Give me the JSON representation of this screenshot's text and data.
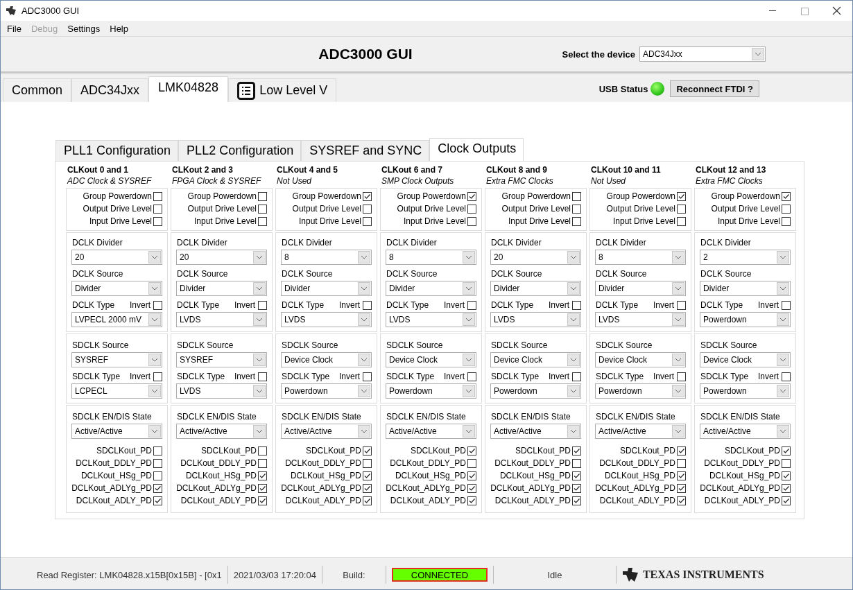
{
  "window": {
    "title": "ADC3000 GUI"
  },
  "menu": [
    {
      "label": "File",
      "disabled": false
    },
    {
      "label": "Debug",
      "disabled": true
    },
    {
      "label": "Settings",
      "disabled": false
    },
    {
      "label": "Help",
      "disabled": false
    }
  ],
  "header": {
    "title": "ADC3000 GUI",
    "device_label": "Select the device",
    "device_value": "ADC34Jxx"
  },
  "main_tabs": [
    {
      "label": "Common",
      "kind": "text",
      "selected": false
    },
    {
      "label": "ADC34Jxx",
      "kind": "text",
      "selected": false
    },
    {
      "label": "LMK04828",
      "kind": "text",
      "selected": true
    },
    {
      "label": "Low Level V",
      "kind": "icon",
      "selected": false
    }
  ],
  "usb": {
    "label": "USB Status",
    "connected": true,
    "button": "Reconnect FTDI ?"
  },
  "sub_tabs": [
    {
      "label": "PLL1 Configuration",
      "selected": false
    },
    {
      "label": "PLL2 Configuration",
      "selected": false
    },
    {
      "label": "SYSREF and SYNC",
      "selected": false
    },
    {
      "label": "Clock Outputs",
      "selected": true
    }
  ],
  "columns": [
    {
      "title": "CLKout 0 and 1",
      "subtitle": "ADC Clock & SYSREF",
      "top_checks": [
        {
          "label": "Group Powerdown",
          "checked": false
        },
        {
          "label": "Output Drive Level",
          "checked": false
        },
        {
          "label": "Input Drive Level",
          "checked": false
        }
      ],
      "dclk_divider": {
        "label": "DCLK Divider",
        "value": "20"
      },
      "dclk_source": {
        "label": "DCLK Source",
        "value": "Divider"
      },
      "dclk_type": {
        "label": "DCLK Type",
        "invert_label": "Invert",
        "invert": false,
        "value": "LVPECL 2000 mV"
      },
      "sdclk_source": {
        "label": "SDCLK Source",
        "value": "SYSREF"
      },
      "sdclk_type": {
        "label": "SDCLK Type",
        "invert_label": "Invert",
        "invert": false,
        "value": "LCPECL"
      },
      "sdclk_state": {
        "label": "SDCLK EN/DIS State",
        "value": "Active/Active"
      },
      "pd_checks": [
        {
          "label": "SDCLKout_PD",
          "checked": false
        },
        {
          "label": "DCLKout_DDLY_PD",
          "checked": false
        },
        {
          "label": "DCLKout_HSg_PD",
          "checked": false
        },
        {
          "label": "DCLKout_ADLYg_PD",
          "checked": true
        },
        {
          "label": "DCLKout_ADLY_PD",
          "checked": true
        }
      ]
    },
    {
      "title": "CLKout 2 and 3",
      "subtitle": "FPGA Clock & SYSREF",
      "top_checks": [
        {
          "label": "Group Powerdown",
          "checked": false
        },
        {
          "label": "Output Drive Level",
          "checked": false
        },
        {
          "label": "Input Drive Level",
          "checked": false
        }
      ],
      "dclk_divider": {
        "label": "DCLK Divider",
        "value": "20"
      },
      "dclk_source": {
        "label": "DCLK Source",
        "value": "Divider"
      },
      "dclk_type": {
        "label": "DCLK Type",
        "invert_label": "Invert",
        "invert": false,
        "value": "LVDS"
      },
      "sdclk_source": {
        "label": "SDCLK Source",
        "value": "SYSREF"
      },
      "sdclk_type": {
        "label": "SDCLK Type",
        "invert_label": "Invert",
        "invert": false,
        "value": "LVDS"
      },
      "sdclk_state": {
        "label": "SDCLK EN/DIS State",
        "value": "Active/Active"
      },
      "pd_checks": [
        {
          "label": "SDCLKout_PD",
          "checked": false
        },
        {
          "label": "DCLKout_DDLY_PD",
          "checked": false
        },
        {
          "label": "DCLKout_HSg_PD",
          "checked": true
        },
        {
          "label": "DCLKout_ADLYg_PD",
          "checked": true
        },
        {
          "label": "DCLKout_ADLY_PD",
          "checked": true
        }
      ]
    },
    {
      "title": "CLKout 4 and 5",
      "subtitle": "Not Used",
      "top_checks": [
        {
          "label": "Group Powerdown",
          "checked": true
        },
        {
          "label": "Output Drive Level",
          "checked": false
        },
        {
          "label": "Input Drive Level",
          "checked": false
        }
      ],
      "dclk_divider": {
        "label": "DCLK Divider",
        "value": "8"
      },
      "dclk_source": {
        "label": "DCLK Source",
        "value": "Divider"
      },
      "dclk_type": {
        "label": "DCLK Type",
        "invert_label": "Invert",
        "invert": false,
        "value": "LVDS"
      },
      "sdclk_source": {
        "label": "SDCLK Source",
        "value": "Device Clock"
      },
      "sdclk_type": {
        "label": "SDCLK Type",
        "invert_label": "Invert",
        "invert": false,
        "value": "Powerdown"
      },
      "sdclk_state": {
        "label": "SDCLK EN/DIS State",
        "value": "Active/Active"
      },
      "pd_checks": [
        {
          "label": "SDCLKout_PD",
          "checked": true
        },
        {
          "label": "DCLKout_DDLY_PD",
          "checked": false
        },
        {
          "label": "DCLKout_HSg_PD",
          "checked": true
        },
        {
          "label": "DCLKout_ADLYg_PD",
          "checked": true
        },
        {
          "label": "DCLKout_ADLY_PD",
          "checked": true
        }
      ]
    },
    {
      "title": "CLKout 6 and 7",
      "subtitle": "SMP Clock Outputs",
      "top_checks": [
        {
          "label": "Group Powerdown",
          "checked": true
        },
        {
          "label": "Output Drive Level",
          "checked": false
        },
        {
          "label": "Input Drive Level",
          "checked": false
        }
      ],
      "dclk_divider": {
        "label": "DCLK Divider",
        "value": "8"
      },
      "dclk_source": {
        "label": "DCLK Source",
        "value": "Divider"
      },
      "dclk_type": {
        "label": "DCLK Type",
        "invert_label": "Invert",
        "invert": false,
        "value": "LVDS"
      },
      "sdclk_source": {
        "label": "SDCLK Source",
        "value": "Device Clock"
      },
      "sdclk_type": {
        "label": "SDCLK Type",
        "invert_label": "Invert",
        "invert": false,
        "value": "Powerdown"
      },
      "sdclk_state": {
        "label": "SDCLK EN/DIS State",
        "value": "Active/Active"
      },
      "pd_checks": [
        {
          "label": "SDCLKout_PD",
          "checked": true
        },
        {
          "label": "DCLKout_DDLY_PD",
          "checked": false
        },
        {
          "label": "DCLKout_HSg_PD",
          "checked": true
        },
        {
          "label": "DCLKout_ADLYg_PD",
          "checked": true
        },
        {
          "label": "DCLKout_ADLY_PD",
          "checked": true
        }
      ]
    },
    {
      "title": "CLKout 8 and 9",
      "subtitle": "Extra FMC Clocks",
      "top_checks": [
        {
          "label": "Group Powerdown",
          "checked": false
        },
        {
          "label": "Output Drive Level",
          "checked": false
        },
        {
          "label": "Input Drive Level",
          "checked": false
        }
      ],
      "dclk_divider": {
        "label": "DCLK Divider",
        "value": "20"
      },
      "dclk_source": {
        "label": "DCLK Source",
        "value": "Divider"
      },
      "dclk_type": {
        "label": "DCLK Type",
        "invert_label": "Invert",
        "invert": false,
        "value": "LVDS"
      },
      "sdclk_source": {
        "label": "SDCLK Source",
        "value": "Device Clock"
      },
      "sdclk_type": {
        "label": "SDCLK Type",
        "invert_label": "Invert",
        "invert": false,
        "value": "Powerdown"
      },
      "sdclk_state": {
        "label": "SDCLK EN/DIS State",
        "value": "Active/Active"
      },
      "pd_checks": [
        {
          "label": "SDCLKout_PD",
          "checked": true
        },
        {
          "label": "DCLKout_DDLY_PD",
          "checked": false
        },
        {
          "label": "DCLKout_HSg_PD",
          "checked": true
        },
        {
          "label": "DCLKout_ADLYg_PD",
          "checked": true
        },
        {
          "label": "DCLKout_ADLY_PD",
          "checked": true
        }
      ]
    },
    {
      "title": "CLKout 10 and 11",
      "subtitle": "Not Used",
      "top_checks": [
        {
          "label": "Group Powerdown",
          "checked": true
        },
        {
          "label": "Output Drive Level",
          "checked": false
        },
        {
          "label": "Input Drive Level",
          "checked": false
        }
      ],
      "dclk_divider": {
        "label": "DCLK Divider",
        "value": "8"
      },
      "dclk_source": {
        "label": "DCLK Source",
        "value": "Divider"
      },
      "dclk_type": {
        "label": "DCLK Type",
        "invert_label": "Invert",
        "invert": false,
        "value": "LVDS"
      },
      "sdclk_source": {
        "label": "SDCLK Source",
        "value": "Device Clock"
      },
      "sdclk_type": {
        "label": "SDCLK Type",
        "invert_label": "Invert",
        "invert": false,
        "value": "Powerdown"
      },
      "sdclk_state": {
        "label": "SDCLK EN/DIS State",
        "value": "Active/Active"
      },
      "pd_checks": [
        {
          "label": "SDCLKout_PD",
          "checked": true
        },
        {
          "label": "DCLKout_DDLY_PD",
          "checked": false
        },
        {
          "label": "DCLKout_HSg_PD",
          "checked": true
        },
        {
          "label": "DCLKout_ADLYg_PD",
          "checked": true
        },
        {
          "label": "DCLKout_ADLY_PD",
          "checked": true
        }
      ]
    },
    {
      "title": "CLKout 12 and 13",
      "subtitle": "Extra FMC Clocks",
      "top_checks": [
        {
          "label": "Group Powerdown",
          "checked": true
        },
        {
          "label": "Output Drive Level",
          "checked": false
        },
        {
          "label": "Input Drive Level",
          "checked": false
        }
      ],
      "dclk_divider": {
        "label": "DCLK Divider",
        "value": "2"
      },
      "dclk_source": {
        "label": "DCLK Source",
        "value": "Divider"
      },
      "dclk_type": {
        "label": "DCLK Type",
        "invert_label": "Invert",
        "invert": false,
        "value": "Powerdown"
      },
      "sdclk_source": {
        "label": "SDCLK Source",
        "value": "Device Clock"
      },
      "sdclk_type": {
        "label": "SDCLK Type",
        "invert_label": "Invert",
        "invert": false,
        "value": "Powerdown"
      },
      "sdclk_state": {
        "label": "SDCLK EN/DIS State",
        "value": "Active/Active"
      },
      "pd_checks": [
        {
          "label": "SDCLKout_PD",
          "checked": true
        },
        {
          "label": "DCLKout_DDLY_PD",
          "checked": false
        },
        {
          "label": "DCLKout_HSg_PD",
          "checked": true
        },
        {
          "label": "DCLKout_ADLYg_PD",
          "checked": true
        },
        {
          "label": "DCLKout_ADLY_PD",
          "checked": true
        }
      ]
    }
  ],
  "status_bar": {
    "register": "Read Register: LMK04828.x15B[0x15B] - [0x1",
    "timestamp": "2021/03/03 17:20:04",
    "build": "Build:",
    "connection": {
      "text": "CONNECTED",
      "connected": true
    },
    "activity": "Idle",
    "logo": "TEXAS INSTRUMENTS"
  }
}
